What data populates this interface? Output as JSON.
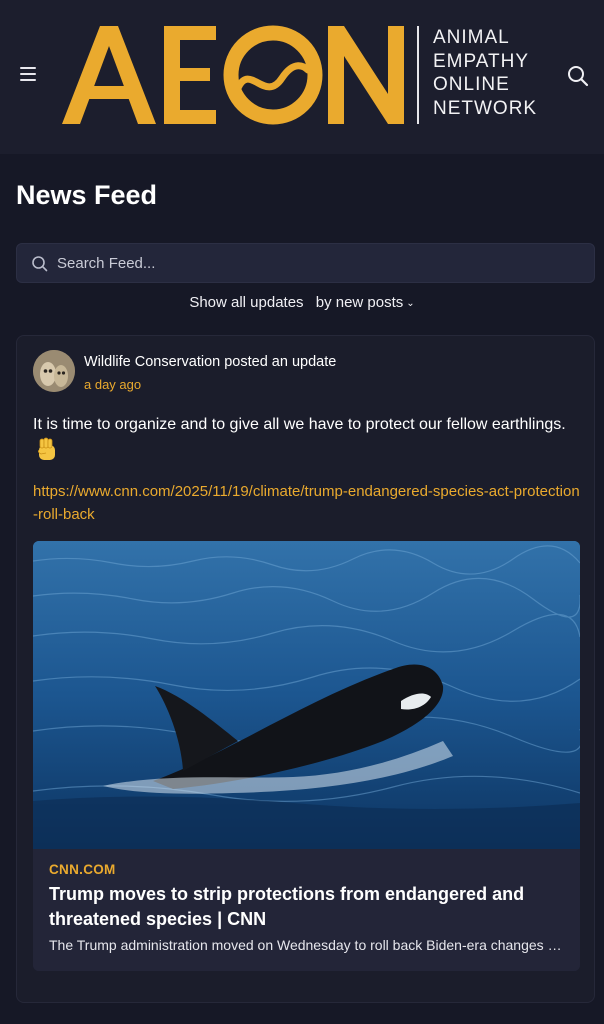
{
  "header": {
    "logo_word": "AEON",
    "logo_tagline": [
      "ANIMAL",
      "EMPATHY",
      "ONLINE",
      "NETWORK"
    ],
    "menu_icon": "hamburger-menu-icon",
    "search_icon": "search-icon"
  },
  "feed": {
    "title": "News Feed",
    "search_placeholder": "Search Feed...",
    "filter_show": "Show all updates",
    "filter_sort": "by new posts"
  },
  "post": {
    "author": "Wildlife Conservation",
    "action": "posted an update",
    "time": "a day ago",
    "text": "It is time to organize and to give all we have to protect our fellow earthlings.",
    "emoji": "raised-fist",
    "link": "https://www.cnn.com/2025/11/19/climate/trump-endangered-species-act-protection-roll-back",
    "preview": {
      "source": "CNN.COM",
      "title": "Trump moves to strip protections from endangered and threatened species | CNN",
      "description": "The Trump administration moved on Wednesday to roll back Biden-era changes to the Endangered Species Act"
    }
  },
  "colors": {
    "accent": "#eaaa2e",
    "background": "#161826",
    "header_bg": "#1c1e2d",
    "card_bg": "#1b1d2b"
  }
}
